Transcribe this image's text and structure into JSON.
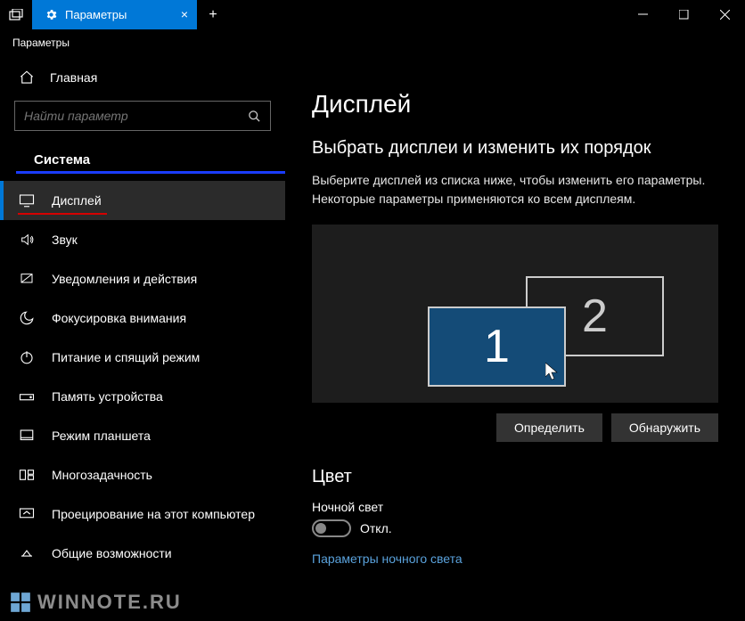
{
  "window": {
    "tab_title": "Параметры",
    "breadcrumb": "Параметры"
  },
  "sidebar": {
    "home": "Главная",
    "search_placeholder": "Найти параметр",
    "group": "Система",
    "items": [
      {
        "label": "Дисплей"
      },
      {
        "label": "Звук"
      },
      {
        "label": "Уведомления и действия"
      },
      {
        "label": "Фокусировка внимания"
      },
      {
        "label": "Питание и спящий режим"
      },
      {
        "label": "Память устройства"
      },
      {
        "label": "Режим планшета"
      },
      {
        "label": "Многозадачность"
      },
      {
        "label": "Проецирование на этот компьютер"
      },
      {
        "label": "Общие возможности"
      }
    ]
  },
  "main": {
    "title": "Дисплей",
    "arrange_heading": "Выбрать дисплеи и изменить их порядок",
    "arrange_help": "Выберите дисплей из списка ниже, чтобы изменить его параметры. Некоторые параметры применяются ко всем дисплеям.",
    "monitor1": "1",
    "monitor2": "2",
    "identify": "Определить",
    "detect": "Обнаружить",
    "color_heading": "Цвет",
    "night_light_label": "Ночной свет",
    "toggle_state": "Откл.",
    "night_light_link": "Параметры ночного света"
  },
  "watermark": "WINNOTE.RU"
}
